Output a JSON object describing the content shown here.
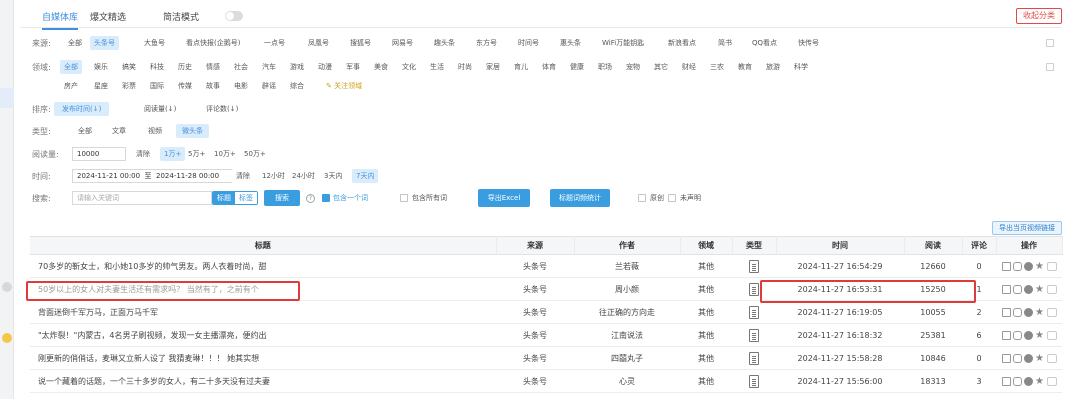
{
  "top": {
    "tabs": [
      {
        "label": "自媒体库",
        "active": true
      },
      {
        "label": "爆文精选",
        "active": false
      },
      {
        "label": "简洁模式",
        "active": false
      }
    ],
    "collapse_label": "收起分类"
  },
  "filters": {
    "source": {
      "label": "来源:",
      "options": [
        "全部",
        "头条号",
        "大鱼号",
        "看点快报(企鹅号)",
        "一点号",
        "凤凰号",
        "搜狐号",
        "网易号",
        "趣头条",
        "东方号",
        "时间号",
        "惠头条",
        "WiFi万能钥匙",
        "新浪看点",
        "简书",
        "QQ看点",
        "快传号"
      ],
      "selected": "头条号"
    },
    "domain": {
      "label": "领域:",
      "row1": [
        "全部",
        "娱乐",
        "搞笑",
        "科技",
        "历史",
        "情感",
        "社会",
        "汽车",
        "游戏",
        "动漫",
        "军事",
        "美食",
        "文化",
        "生活",
        "时尚",
        "家居",
        "育儿",
        "体育",
        "健康",
        "职场",
        "宠物",
        "其它",
        "财经",
        "三农",
        "教育",
        "旅游",
        "科学"
      ],
      "row2": [
        "房产",
        "星座",
        "彩票",
        "国际",
        "传媒",
        "故事",
        "电影",
        "辟谣",
        "综合"
      ],
      "follow_label": "关注领域",
      "selected": "全部"
    },
    "sort": {
      "label": "排序:",
      "options": [
        "发布时间(↓)",
        "阅读量(↓)",
        "评论数(↓)"
      ],
      "selected": "发布时间(↓)"
    },
    "type": {
      "label": "类型:",
      "options": [
        "全部",
        "文章",
        "视频",
        "微头条"
      ],
      "selected": "微头条"
    },
    "reads": {
      "label": "阅读量:",
      "value": "10000",
      "clear": "清除",
      "options": [
        "1万+",
        "5万+",
        "10万+",
        "50万+"
      ],
      "selected": "1万+"
    },
    "time": {
      "label": "时间:",
      "start": "2024-11-21 00:00",
      "sep": "至",
      "end": "2024-11-28 00:00",
      "clear": "清除",
      "options": [
        "12小时",
        "24小时",
        "3天内",
        "7天内"
      ],
      "selected": "7天内"
    },
    "search": {
      "label": "搜索:",
      "placeholder": "请输入关键词",
      "toggle_on": "标题",
      "toggle_off": "标签",
      "button": "搜索",
      "help": "?",
      "opt1": "包含一个词",
      "opt2": "包含所有词",
      "export_excel": "导出Excel",
      "stats_button": "标题词频统计",
      "opt3": "原创",
      "opt4": "未声明"
    }
  },
  "export_video_links": "导出当页视频链接",
  "table": {
    "headers": [
      "标题",
      "来源",
      "作者",
      "领域",
      "类型",
      "时间",
      "阅读",
      "评论",
      "操作"
    ],
    "rows": [
      {
        "title": "70多岁的靳女士，和小她10多岁的帅气男友。两人衣着时尚，甜",
        "source": "头条号",
        "author": "兰若薇",
        "domain": "其他",
        "time": "2024-11-27 16:54:29",
        "reads": "12660",
        "comments": "0"
      },
      {
        "title": "50岁以上的女人对夫妻生活还有需求吗？ 当然有了，之前有个",
        "source": "头条号",
        "author": "周小颜",
        "domain": "其他",
        "time": "2024-11-27 16:53:31",
        "reads": "15250",
        "comments": "1"
      },
      {
        "title": "背面迷倒千军万马，正面万马千军",
        "source": "头条号",
        "author": "往正确的方向走",
        "domain": "其他",
        "time": "2024-11-27 16:19:05",
        "reads": "10055",
        "comments": "2"
      },
      {
        "title": "\"太炸裂！\"内蒙古，4名男子刷视频，发现一女主播漂亮，便约出",
        "source": "头条号",
        "author": "江南说法",
        "domain": "其他",
        "time": "2024-11-27 16:18:32",
        "reads": "25381",
        "comments": "6"
      },
      {
        "title": "刚更新的俏俏话，麦琳又立新人设了 我猜麦琳！！！ 她其实想",
        "source": "头条号",
        "author": "四囍丸子",
        "domain": "其他",
        "time": "2024-11-27 15:58:28",
        "reads": "10846",
        "comments": "0"
      },
      {
        "title": "说一个藏着的话题，一个三十多岁的女人，有二十多天没有过夫妻",
        "source": "头条号",
        "author": "心灵",
        "domain": "其他",
        "time": "2024-11-27 15:56:00",
        "reads": "18313",
        "comments": "3"
      }
    ]
  },
  "colors": {
    "accent": "#3a9de0",
    "highlight": "#e03b3b"
  }
}
